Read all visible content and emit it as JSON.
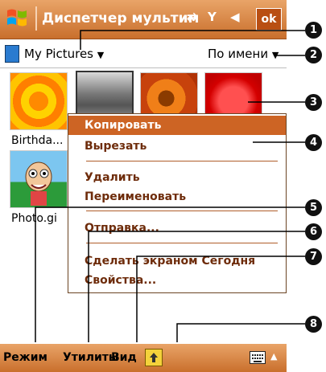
{
  "title_bar": {
    "title": "Диспетчер мультим",
    "ok_label": "ok"
  },
  "folder_bar": {
    "folder": "My Pictures",
    "sort": "По имени"
  },
  "thumbnails": [
    {
      "caption": "Birthda..."
    },
    {
      "caption": ""
    },
    {
      "caption": ""
    },
    {
      "caption": ""
    },
    {
      "caption": "Photo.gi"
    }
  ],
  "context_menu": {
    "items": [
      "Копировать",
      "Вырезать",
      "Удалить",
      "Переименовать",
      "Отправка...",
      "Сделать экраном Сегодня",
      "Свойства..."
    ],
    "selected_index": 0
  },
  "bottom_bar": {
    "mode": "Режим",
    "tools": "Утилиты",
    "view": "Вид"
  },
  "callouts": [
    "1",
    "2",
    "3",
    "4",
    "5",
    "6",
    "7",
    "8"
  ],
  "colors": {
    "accent": "#cd6424",
    "menu_text": "#6e2c0b",
    "bar_top": "#e9a468",
    "bar_bottom": "#c96f2c"
  },
  "icons": [
    "windows-logo-icon",
    "connectivity-icon",
    "signal-icon",
    "volume-icon",
    "folder-icon",
    "dropdown-arrow-icon",
    "up-folder-icon",
    "keyboard-icon"
  ]
}
